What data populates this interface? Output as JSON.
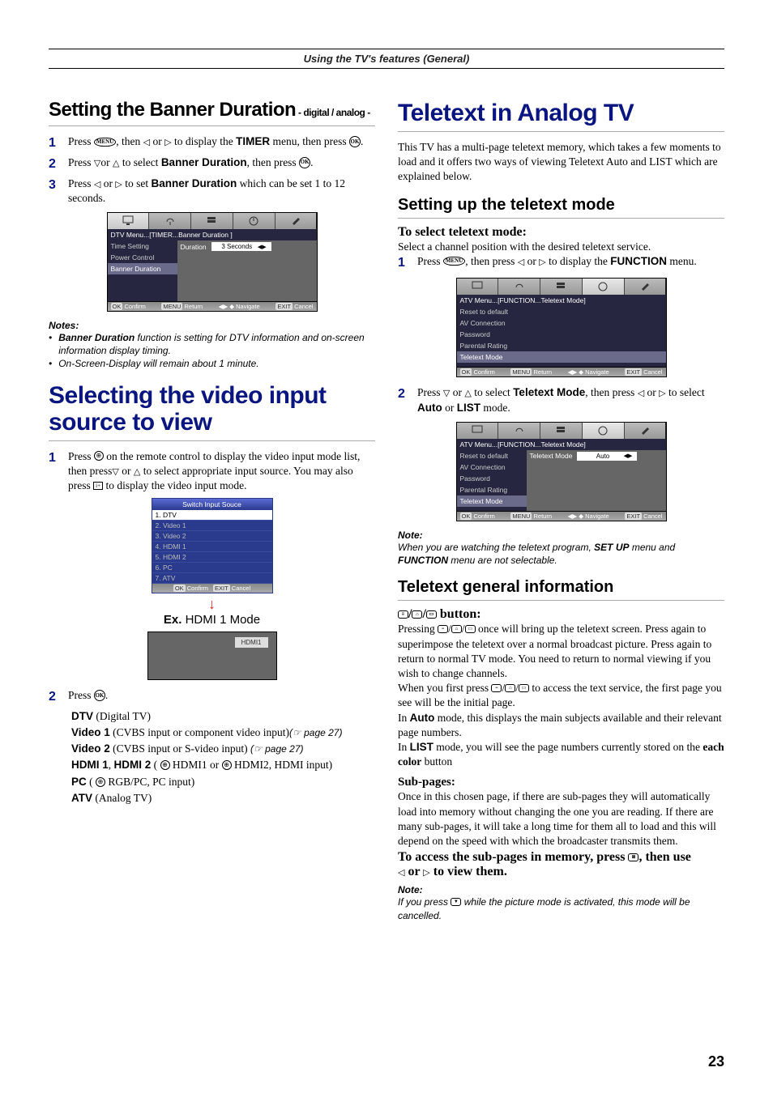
{
  "header": "Using the TV's features (General)",
  "page_number": "23",
  "left": {
    "sec1": {
      "title_main": "Setting the Banner Duration",
      "title_sub": " - digital / analog -",
      "steps": {
        "s1a": "Press ",
        "s1b": ", then ",
        "s1c": " or ",
        "s1d": " to display the ",
        "s1e": "TIMER",
        "s1f": " menu, then press ",
        "s1g": ".",
        "s2a": "Press ",
        "s2b": "or ",
        "s2c": " to select ",
        "s2d": "Banner Duration",
        "s2e": ", then press ",
        "s2f": ".",
        "s3a": "Press ",
        "s3b": " or ",
        "s3c": " to set ",
        "s3d": "Banner Duration",
        "s3e": " which can be set 1 to 12 seconds."
      },
      "menu": {
        "crumb": "DTV Menu...[TIMER...Banner Duration ]",
        "side": [
          "Time Setting",
          "Power Control",
          "Banner Duration"
        ],
        "label": "Duration",
        "value": "3 Seconds",
        "foot": [
          "OK",
          "Confirm",
          "MENU",
          "Return",
          "◀▶ ◆ Navigate",
          "EXIT",
          "Cancel"
        ]
      },
      "notes_head": "Notes:",
      "note1_a": "Banner Duration",
      "note1_b": " function is setting for DTV information and on-screen information display timing.",
      "note2": "On-Screen-Display will remain about 1 minute."
    },
    "sec2": {
      "title": "Selecting the video input source to view",
      "s1a": "Press ",
      "s1b": " on the remote control to display the video input mode list, then press",
      "s1c": " or ",
      "s1d": " to select appropriate input source. You may also press ",
      "s1e": " to display the video input mode.",
      "switch": {
        "head": "Switch Input Souce",
        "items": [
          "1. DTV",
          "2. Video 1",
          "3. Video 2",
          "4. HDMI 1",
          "5. HDMI 2",
          "6. PC",
          "7. ATV"
        ],
        "foot": [
          "OK",
          "Confirm",
          "EXIT",
          "Cancel"
        ]
      },
      "ex_bold": "Ex.",
      "ex_rest": " HDMI 1 Mode",
      "hdmi_badge": "HDMI1",
      "s2a": "Press ",
      "s2b": ".",
      "defs": {
        "dtv_a": "DTV",
        "dtv_b": " (Digital TV)",
        "v1_a": "Video 1",
        "v1_b": " (CVBS input  or component video input)",
        "v1_c": "(☞ page 27)",
        "v2_a": "Video 2",
        "v2_b": " (CVBS input  or S-video input) ",
        "v2_c": "(☞ page 27)",
        "h_a": "HDMI 1",
        "comma": ", ",
        "h_b": "HDMI 2",
        "h_c": " ( ",
        "h_d": " HDMI1 or  ",
        "h_e": " HDMI2, HDMI input)",
        "pc_a": "PC",
        "pc_b": " ( ",
        "pc_c": " RGB/PC, PC input)",
        "atv_a": "ATV",
        "atv_b": " (Analog TV)"
      }
    }
  },
  "right": {
    "title_big": "Teletext in Analog TV",
    "intro": "This TV has a multi-page teletext memory, which takes a few moments to load and it offers two ways of viewing Teletext Auto and LIST which are explained below.",
    "sec1": {
      "title": "Setting up the teletext mode",
      "sub": "To select teletext mode:",
      "sub2": "Select a channel position with the desired teletext service.",
      "s1a": "Press ",
      "s1b": ", then press ",
      "s1c": " or ",
      "s1d": " to display the ",
      "s1e": "FUNCTION",
      "s1f": " menu.",
      "menu1": {
        "crumb": "ATV Menu...[FUNCTION...Teletext Mode]",
        "side": [
          "Reset to default",
          "AV Connection",
          "Password",
          "Parental Rating",
          "Teletext Mode"
        ],
        "foot": [
          "OK",
          "Confirm",
          "MENU",
          "Return",
          "◀▶ ◆ Navigate",
          "EXIT",
          "Cancel"
        ]
      },
      "s2a": "Press ",
      "s2b": " or ",
      "s2c": " to select ",
      "s2d": "Teletext Mode",
      "s2e": ", then press ",
      "s2f": " or ",
      "s2g": " to select ",
      "s2h": "Auto",
      "s2i": " or ",
      "s2j": "LIST",
      "s2k": " mode.",
      "menu2": {
        "crumb": "ATV Menu...[FUNCTION...Teletext Mode]",
        "side": [
          "Reset to default",
          "AV Connection",
          "Password",
          "Parental Rating",
          "Teletext Mode"
        ],
        "label": "Teletext Mode",
        "value": "Auto",
        "foot": [
          "OK",
          "Confirm",
          "MENU",
          "Return",
          "◀▶ ◆ Navigate",
          "EXIT",
          "Cancel"
        ]
      },
      "note_head": "Note:",
      "note_a": "When you are watching the teletext program, ",
      "note_b": "SET UP",
      "note_c": " menu and ",
      "note_d": "FUNCTION",
      "note_e": " menu are not selectable."
    },
    "sec2": {
      "title": "Teletext general information",
      "btn_label": " button:",
      "p1a": "Pressing ",
      "p1b": " once will bring up the teletext screen. Press again to superimpose the teletext over a normal broadcast picture. Press again to return to normal TV mode. You need to return to normal viewing if you wish to change channels.",
      "p2a": "When you first press ",
      "p2b": " to access the text service, the first page you see will be the initial page.",
      "p3a": "In ",
      "p3b": "Auto",
      "p3c": " mode, this displays the main subjects available and their relevant page numbers.",
      "p4a": "In ",
      "p4b": "LIST",
      "p4c": " mode, you will see the page numbers currently stored on the ",
      "p4d": "each color",
      "p4e": " button",
      "sub2": "Sub-pages:",
      "sp1": "Once in this chosen page, if there are sub-pages they will automatically load into memory without changing the one you are reading. If there are many sub-pages, it will take a long time for them all to load and this will depend on the speed with which the broadcaster transmits them.",
      "sp2a": "To access the sub-pages in memory, press ",
      "sp2b": ", then use",
      "sp3a": " or ",
      "sp3b": " to view them.",
      "note2_head": "Note:",
      "note2_a": "If you press ",
      "note2_b": " while the picture mode is activated, this mode will be cancelled."
    }
  }
}
